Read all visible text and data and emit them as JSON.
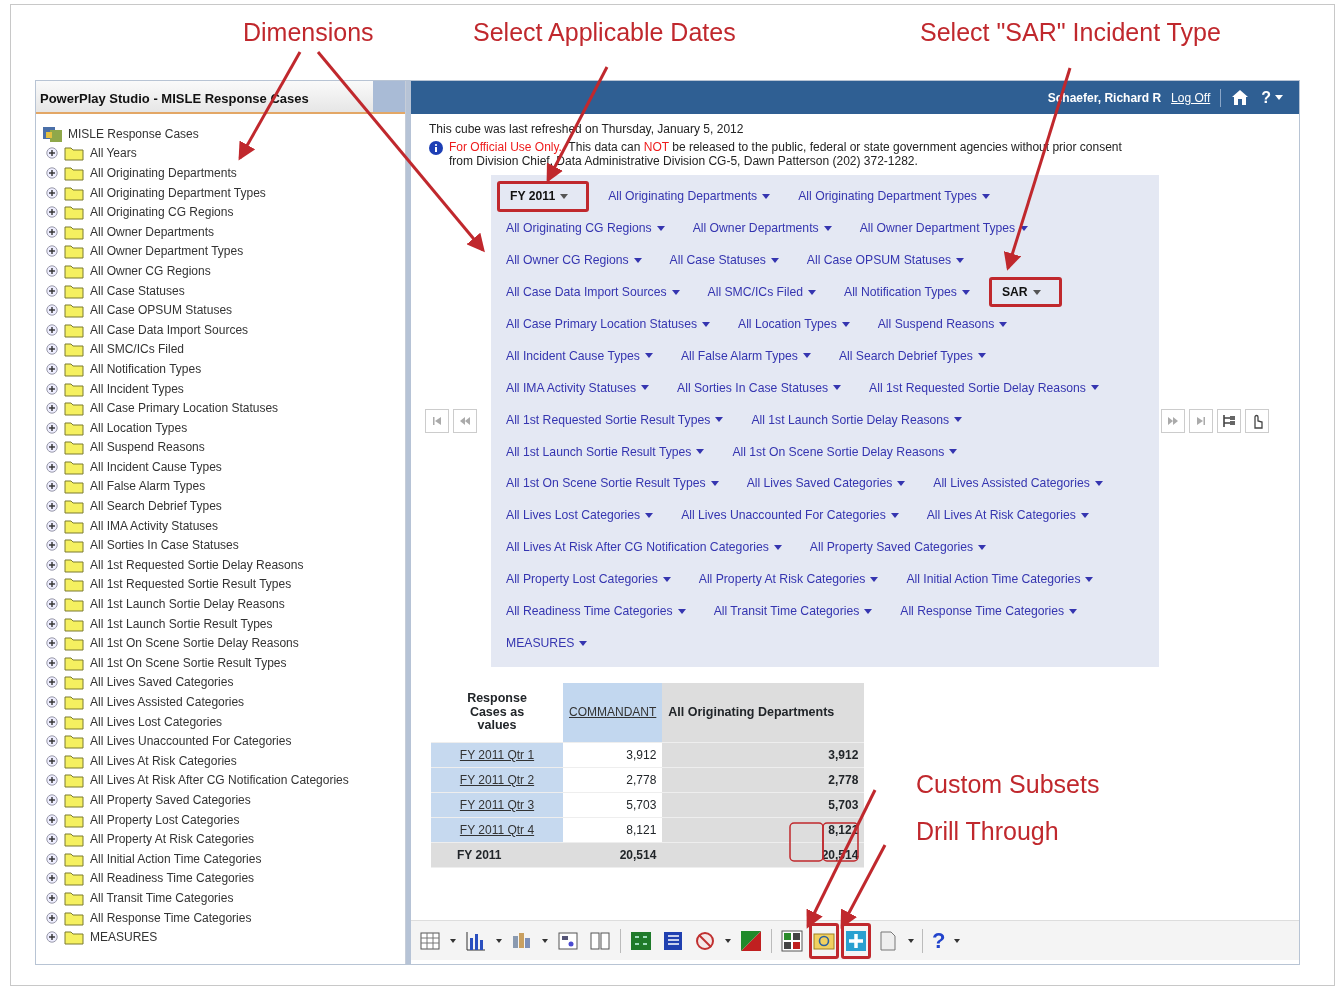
{
  "annotations": [
    {
      "text": "Dimensions"
    },
    {
      "text": "Select Applicable Dates"
    },
    {
      "text": "Select \"SAR\" Incident Type"
    },
    {
      "text": "Custom Subsets"
    },
    {
      "text": "Drill Through"
    }
  ],
  "app_title": "PowerPlay Studio - MISLE Response Cases",
  "header": {
    "user": "Schaefer, Richard R",
    "log_off": "Log Off",
    "help_glyph": "?"
  },
  "tree": {
    "root": "MISLE Response Cases",
    "children": [
      {
        "label": "All Years",
        "expanded": false
      },
      {
        "label": "All Originating Departments",
        "expanded": false
      },
      {
        "label": "All Originating Department Types",
        "expanded": false
      },
      {
        "label": "All Originating CG Regions",
        "expanded": false
      },
      {
        "label": "All Owner Departments",
        "expanded": false
      },
      {
        "label": "All Owner Department Types",
        "expanded": false
      },
      {
        "label": "All Owner CG Regions",
        "expanded": false
      },
      {
        "label": "All Case Statuses",
        "expanded": false
      },
      {
        "label": "All Case OPSUM Statuses",
        "expanded": false
      },
      {
        "label": "All Case Data Import Sources",
        "expanded": false
      },
      {
        "label": "All SMC/ICs Filed",
        "expanded": false
      },
      {
        "label": "All Notification Types",
        "expanded": false
      },
      {
        "label": "All Incident Types",
        "expanded": false
      },
      {
        "label": "All Case Primary Location Statuses",
        "expanded": false
      },
      {
        "label": "All Location Types",
        "expanded": false
      },
      {
        "label": "All Suspend Reasons",
        "expanded": false
      },
      {
        "label": "All Incident Cause Types",
        "expanded": false
      },
      {
        "label": "All False Alarm Types",
        "expanded": false
      },
      {
        "label": "All Search Debrief Types",
        "expanded": false
      },
      {
        "label": "All IMA Activity Statuses",
        "expanded": false
      },
      {
        "label": "All Sorties In Case Statuses",
        "expanded": false
      },
      {
        "label": "All 1st Requested Sortie Delay Reasons",
        "expanded": false
      },
      {
        "label": "All 1st Requested Sortie Result Types",
        "expanded": false
      },
      {
        "label": "All 1st Launch Sortie Delay Reasons",
        "expanded": false
      },
      {
        "label": "All 1st Launch Sortie Result Types",
        "expanded": false
      },
      {
        "label": "All 1st On Scene Sortie Delay Reasons",
        "expanded": false
      },
      {
        "label": "All 1st On Scene Sortie Result Types",
        "expanded": false
      },
      {
        "label": "All Lives Saved Categories",
        "expanded": false
      },
      {
        "label": "All Lives Assisted Categories",
        "expanded": false
      },
      {
        "label": "All Lives Lost Categories",
        "expanded": false
      },
      {
        "label": "All Lives Unaccounted For Categories",
        "expanded": false
      },
      {
        "label": "All Lives At Risk Categories",
        "expanded": false
      },
      {
        "label": "All Lives At Risk After CG Notification Categories",
        "expanded": false
      },
      {
        "label": "All Property Saved Categories",
        "expanded": false
      },
      {
        "label": "All Property Lost Categories",
        "expanded": false
      },
      {
        "label": "All Property At Risk Categories",
        "expanded": false
      },
      {
        "label": "All Initial Action Time Categories",
        "expanded": false
      },
      {
        "label": "All Readiness Time Categories",
        "expanded": false
      },
      {
        "label": "All Transit Time Categories",
        "expanded": false
      },
      {
        "label": "All Response Time Categories",
        "expanded": false
      },
      {
        "label": "MEASURES",
        "expanded": false
      }
    ]
  },
  "refresh_note": "This cube was last refreshed on Thursday, January 5, 2012",
  "notice": [
    {
      "text": "For Official Use Only.",
      "emphasis": true
    },
    {
      "text": "  This data can ",
      "emphasis": false
    },
    {
      "text": "NOT",
      "emphasis": true
    },
    {
      "text": " be released to the public, federal or state government agencies without prior consent from Division Chief, Data Administrative Division CG-5, Dawn Patterson (202) 372-1282.",
      "emphasis": false
    }
  ],
  "dimension_rows": [
    [
      {
        "label": "FY 2011",
        "highlighted": true
      },
      {
        "label": "All Originating Departments",
        "highlighted": false
      },
      {
        "label": "All Originating Department Types",
        "highlighted": false
      }
    ],
    [
      {
        "label": "All Originating CG Regions",
        "highlighted": false
      },
      {
        "label": "All Owner Departments",
        "highlighted": false
      },
      {
        "label": "All Owner Department Types",
        "highlighted": false
      }
    ],
    [
      {
        "label": "All Owner CG Regions",
        "highlighted": false
      },
      {
        "label": "All Case Statuses",
        "highlighted": false
      },
      {
        "label": "All Case OPSUM Statuses",
        "highlighted": false
      }
    ],
    [
      {
        "label": "All Case Data Import Sources",
        "highlighted": false
      },
      {
        "label": "All SMC/ICs Filed",
        "highlighted": false
      },
      {
        "label": "All Notification Types",
        "highlighted": false
      },
      {
        "label": "SAR",
        "highlighted": true
      }
    ],
    [
      {
        "label": "All Case Primary Location Statuses",
        "highlighted": false
      },
      {
        "label": "All Location Types",
        "highlighted": false
      },
      {
        "label": "All Suspend Reasons",
        "highlighted": false
      }
    ],
    [
      {
        "label": "All Incident Cause Types",
        "highlighted": false
      },
      {
        "label": "All False Alarm Types",
        "highlighted": false
      },
      {
        "label": "All Search Debrief Types",
        "highlighted": false
      }
    ],
    [
      {
        "label": "All IMA Activity Statuses",
        "highlighted": false
      },
      {
        "label": "All Sorties In Case Statuses",
        "highlighted": false
      },
      {
        "label": "All 1st Requested Sortie Delay Reasons",
        "highlighted": false
      }
    ],
    [
      {
        "label": "All 1st Requested Sortie Result Types",
        "highlighted": false
      },
      {
        "label": "All 1st Launch Sortie Delay Reasons",
        "highlighted": false
      }
    ],
    [
      {
        "label": "All 1st Launch Sortie Result Types",
        "highlighted": false
      },
      {
        "label": "All 1st On Scene Sortie Delay Reasons",
        "highlighted": false
      }
    ],
    [
      {
        "label": "All 1st On Scene Sortie Result Types",
        "highlighted": false
      },
      {
        "label": "All Lives Saved Categories",
        "highlighted": false
      },
      {
        "label": "All Lives Assisted Categories",
        "highlighted": false
      }
    ],
    [
      {
        "label": "All Lives Lost Categories",
        "highlighted": false
      },
      {
        "label": "All Lives Unaccounted For Categories",
        "highlighted": false
      },
      {
        "label": "All Lives At Risk Categories",
        "highlighted": false
      }
    ],
    [
      {
        "label": "All Lives At Risk After CG Notification Categories",
        "highlighted": false
      },
      {
        "label": "All Property Saved Categories",
        "highlighted": false
      }
    ],
    [
      {
        "label": "All Property Lost Categories",
        "highlighted": false
      },
      {
        "label": "All Property At Risk Categories",
        "highlighted": false
      },
      {
        "label": "All Initial Action Time Categories",
        "highlighted": false
      }
    ],
    [
      {
        "label": "All Readiness Time Categories",
        "highlighted": false
      },
      {
        "label": "All Transit Time Categories",
        "highlighted": false
      },
      {
        "label": "All Response Time Categories",
        "highlighted": false
      }
    ],
    [
      {
        "label": "MEASURES",
        "highlighted": false
      }
    ]
  ],
  "crosstab": {
    "corner": "Response Cases as values",
    "columns": [
      "COMMANDANT",
      "All Originating Departments"
    ],
    "rows": [
      {
        "label": "FY 2011 Qtr 1",
        "values": [
          "3,912",
          "3,912"
        ]
      },
      {
        "label": "FY 2011 Qtr 2",
        "values": [
          "2,778",
          "2,778"
        ]
      },
      {
        "label": "FY 2011 Qtr 3",
        "values": [
          "5,703",
          "5,703"
        ]
      },
      {
        "label": "FY 2011 Qtr 4",
        "values": [
          "8,121",
          "8,121"
        ]
      }
    ],
    "total": {
      "label": "FY 2011",
      "values": [
        "20,514",
        "20,514"
      ]
    }
  },
  "toolbar": [
    {
      "kind": "crosstab",
      "dropdown": true,
      "flagged": false
    },
    {
      "kind": "bar-chart",
      "dropdown": true,
      "flagged": false
    },
    {
      "kind": "chart-3d",
      "dropdown": true,
      "flagged": false
    },
    {
      "kind": "layout",
      "dropdown": false,
      "flagged": false
    },
    {
      "kind": "columns",
      "dropdown": false,
      "flagged": false,
      "separator": true
    },
    {
      "kind": "green-grid",
      "dropdown": false,
      "flagged": false
    },
    {
      "kind": "list",
      "dropdown": false,
      "flagged": false
    },
    {
      "kind": "no-sign",
      "dropdown": true,
      "flagged": false
    },
    {
      "kind": "red-chart",
      "dropdown": false,
      "flagged": false,
      "separator": true
    },
    {
      "kind": "swap",
      "dropdown": false,
      "flagged": false
    },
    {
      "kind": "subset",
      "dropdown": false,
      "flagged": true
    },
    {
      "kind": "drill",
      "dropdown": false,
      "flagged": true
    },
    {
      "kind": "document",
      "dropdown": true,
      "flagged": false,
      "separator": true
    },
    {
      "kind": "help",
      "glyph": "?",
      "dropdown": true,
      "flagged": false
    }
  ]
}
